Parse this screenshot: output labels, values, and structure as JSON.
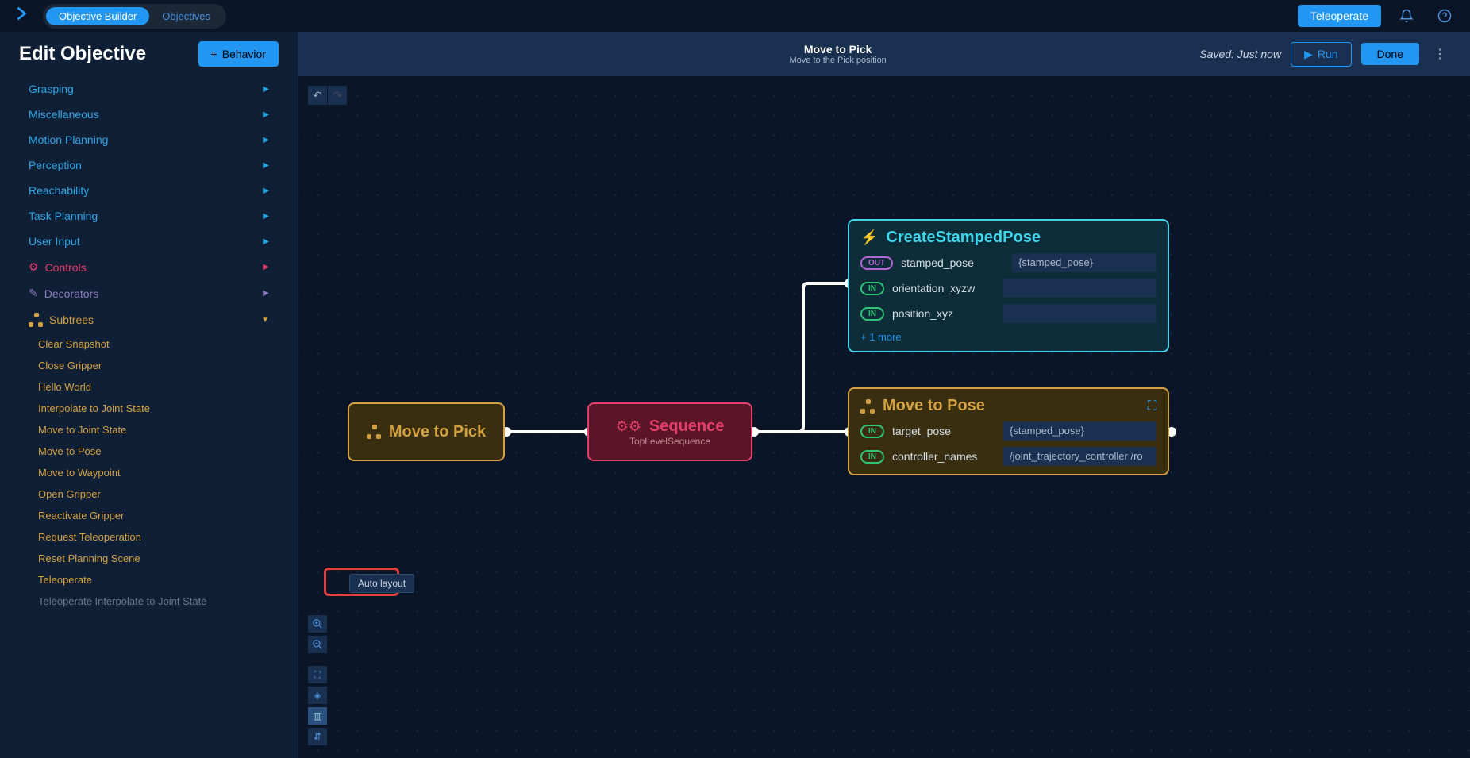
{
  "topbar": {
    "tab_builder": "Objective Builder",
    "tab_objectives": "Objectives",
    "teleoperate": "Teleoperate"
  },
  "sidebar": {
    "title": "Edit Objective",
    "add_behavior": "Behavior",
    "categories": [
      {
        "label": "Grasping",
        "style": "blue"
      },
      {
        "label": "Miscellaneous",
        "style": "blue"
      },
      {
        "label": "Motion Planning",
        "style": "blue"
      },
      {
        "label": "Perception",
        "style": "blue"
      },
      {
        "label": "Reachability",
        "style": "blue"
      },
      {
        "label": "Task Planning",
        "style": "blue"
      },
      {
        "label": "User Input",
        "style": "blue"
      },
      {
        "label": "Controls",
        "style": "red"
      },
      {
        "label": "Decorators",
        "style": "purple"
      },
      {
        "label": "Subtrees",
        "style": "orange",
        "expanded": true
      }
    ],
    "subtrees": [
      "Clear Snapshot",
      "Close Gripper",
      "Hello World",
      "Interpolate to Joint State",
      "Move to Joint State",
      "Move to Pose",
      "Move to Waypoint",
      "Open Gripper",
      "Reactivate Gripper",
      "Request Teleoperation",
      "Reset Planning Scene",
      "Teleoperate"
    ],
    "subtrees_muted": [
      "Teleoperate Interpolate to Joint State"
    ]
  },
  "canvas_header": {
    "title": "Move to Pick",
    "subtitle": "Move to the Pick position",
    "saved": "Saved: Just now",
    "run": "Run",
    "done": "Done"
  },
  "tooltip": "Auto layout",
  "nodes": {
    "pick": {
      "title": "Move to Pick"
    },
    "sequence": {
      "title": "Sequence",
      "subtitle": "TopLevelSequence"
    },
    "create": {
      "title": "CreateStampedPose",
      "ports": [
        {
          "type": "OUT",
          "name": "stamped_pose",
          "value": "{stamped_pose}"
        },
        {
          "type": "IN",
          "name": "orientation_xyzw",
          "value": ""
        },
        {
          "type": "IN",
          "name": "position_xyz",
          "value": ""
        }
      ],
      "more": "+ 1 more"
    },
    "move": {
      "title": "Move to Pose",
      "ports": [
        {
          "type": "IN",
          "name": "target_pose",
          "value": "{stamped_pose}"
        },
        {
          "type": "IN",
          "name": "controller_names",
          "value": "/joint_trajectory_controller /ro"
        }
      ]
    }
  },
  "colors": {
    "accent": "#2196f3",
    "orange": "#d4a142",
    "red": "#e53e6a",
    "purple": "#8e7cc3",
    "teal": "#3dd6ed"
  }
}
